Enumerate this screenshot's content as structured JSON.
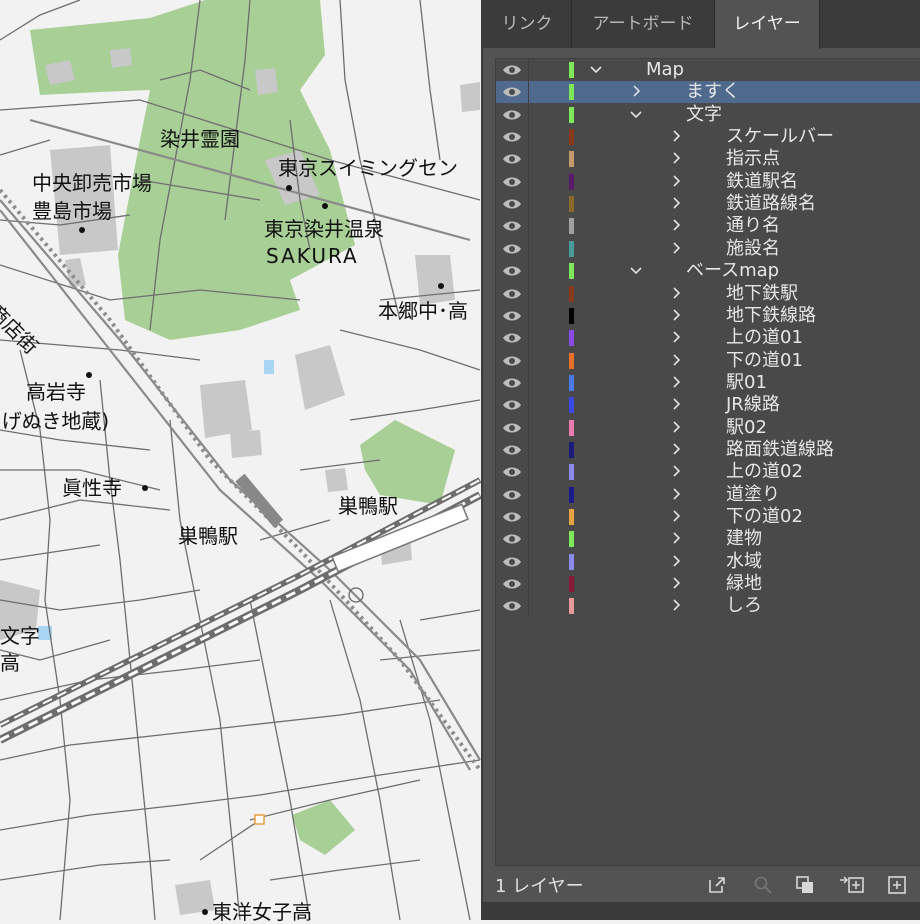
{
  "map": {
    "labels": [
      {
        "text": "染井霊園",
        "dot": false
      },
      {
        "text": "東京スイミングセン",
        "dot": true
      },
      {
        "text": "中央卸売市場",
        "dot": false
      },
      {
        "text": "豊島市場",
        "dot": false
      },
      {
        "text": "東京染井温泉",
        "dot": false
      },
      {
        "text": "SAKURA",
        "dot": false
      },
      {
        "text": "本郷中･高",
        "dot": false
      },
      {
        "text": "商店街",
        "dot": false
      },
      {
        "text": "高岩寺",
        "dot": false
      },
      {
        "text": "(とげぬき地蔵)",
        "dot": false
      },
      {
        "text": "眞性寺",
        "dot": false
      },
      {
        "text": "巣鴨駅",
        "dot": false
      },
      {
        "text": "巣鴨駅",
        "dot": false
      },
      {
        "text": "文字",
        "dot": false
      },
      {
        "text": "高",
        "dot": false
      },
      {
        "text": "東洋女子高",
        "dot": true
      }
    ]
  },
  "panel": {
    "tabs": [
      {
        "label": "リンク",
        "active": false
      },
      {
        "label": "アートボード",
        "active": false
      },
      {
        "label": "レイヤー",
        "active": true
      }
    ],
    "layers": [
      {
        "name": "Map",
        "level": 0,
        "expanded": true,
        "color": "#7de85a",
        "selected": false
      },
      {
        "name": "ますく",
        "level": 1,
        "expanded": false,
        "color": "#7de85a",
        "selected": true
      },
      {
        "name": "文字",
        "level": 1,
        "expanded": true,
        "color": "#7de85a",
        "selected": false
      },
      {
        "name": "スケールバー",
        "level": 2,
        "expanded": false,
        "color": "#8a3a1c",
        "selected": false
      },
      {
        "name": "指示点",
        "level": 2,
        "expanded": false,
        "color": "#c49a6c",
        "selected": false
      },
      {
        "name": "鉄道駅名",
        "level": 2,
        "expanded": false,
        "color": "#5a1a6a",
        "selected": false
      },
      {
        "name": "鉄道路線名",
        "level": 2,
        "expanded": false,
        "color": "#8a6a2a",
        "selected": false
      },
      {
        "name": "通り名",
        "level": 2,
        "expanded": false,
        "color": "#a0a0a0",
        "selected": false
      },
      {
        "name": "施設名",
        "level": 2,
        "expanded": false,
        "color": "#4a9a9a",
        "selected": false
      },
      {
        "name": "ベースmap",
        "level": 1,
        "expanded": true,
        "color": "#7de85a",
        "selected": false
      },
      {
        "name": "地下鉄駅",
        "level": 2,
        "expanded": false,
        "color": "#8a3a1c",
        "selected": false
      },
      {
        "name": "地下鉄線路",
        "level": 2,
        "expanded": false,
        "color": "#000000",
        "selected": false
      },
      {
        "name": "上の道01",
        "level": 2,
        "expanded": false,
        "color": "#8a4ae8",
        "selected": false
      },
      {
        "name": "下の道01",
        "level": 2,
        "expanded": false,
        "color": "#e8702a",
        "selected": false
      },
      {
        "name": "駅01",
        "level": 2,
        "expanded": false,
        "color": "#4a7ae8",
        "selected": false
      },
      {
        "name": "JR線路",
        "level": 2,
        "expanded": false,
        "color": "#3a4ae8",
        "selected": false
      },
      {
        "name": "駅02",
        "level": 2,
        "expanded": false,
        "color": "#e87ab0",
        "selected": false
      },
      {
        "name": "路面鉄道線路",
        "level": 2,
        "expanded": false,
        "color": "#1a1a7a",
        "selected": false
      },
      {
        "name": "上の道02",
        "level": 2,
        "expanded": false,
        "color": "#8a8ae8",
        "selected": false
      },
      {
        "name": "道塗り",
        "level": 2,
        "expanded": false,
        "color": "#1a1a8a",
        "selected": false
      },
      {
        "name": "下の道02",
        "level": 2,
        "expanded": false,
        "color": "#e8a040",
        "selected": false
      },
      {
        "name": "建物",
        "level": 2,
        "expanded": false,
        "color": "#7de85a",
        "selected": false
      },
      {
        "name": "水域",
        "level": 2,
        "expanded": false,
        "color": "#8a8ae8",
        "selected": false
      },
      {
        "name": "緑地",
        "level": 2,
        "expanded": false,
        "color": "#8a1a3a",
        "selected": false
      },
      {
        "name": "しろ",
        "level": 2,
        "expanded": false,
        "color": "#e89a9a",
        "selected": false
      }
    ],
    "footer": {
      "count_label": "1 レイヤー",
      "icons": [
        "export-icon",
        "search-icon",
        "clipping-mask-icon",
        "new-sublayer-icon",
        "new-layer-icon"
      ]
    }
  }
}
